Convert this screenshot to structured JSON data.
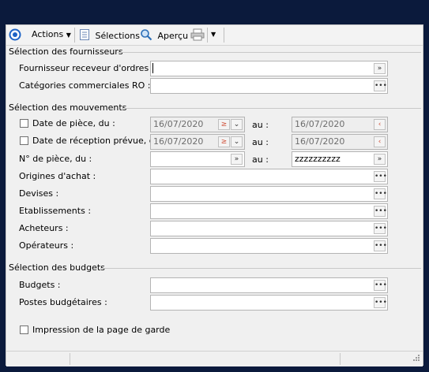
{
  "toolbar": {
    "actions": "Actions",
    "selections": "Sélections",
    "preview": "Aperçu"
  },
  "sections": {
    "suppliers": "Sélection des fournisseurs",
    "movements": "Sélection des mouvements",
    "budgets": "Sélection des budgets"
  },
  "suppliers": {
    "supplier_label": "Fournisseur receveur d'ordres :",
    "supplier_value": "",
    "categories_label": "Catégories commerciales RO :",
    "categories_value": ""
  },
  "movements": {
    "piece_date_label": "Date de pièce, du :",
    "piece_date_from": "16/07/2020",
    "piece_date_to": "16/07/2020",
    "reception_date_label": "Date de réception prévue, du :",
    "reception_date_from": "16/07/2020",
    "reception_date_to": "16/07/2020",
    "piece_no_label": "N° de pièce, du :",
    "piece_no_from": "",
    "piece_no_to": "zzzzzzzzzz",
    "to_label": "au :",
    "origins_label": "Origines d'achat :",
    "currencies_label": "Devises :",
    "establishments_label": "Etablissements :",
    "buyers_label": "Acheteurs :",
    "operators_label": "Opérateurs :"
  },
  "budgets": {
    "budgets_label": "Budgets :",
    "budget_items_label": "Postes budgétaires :"
  },
  "options": {
    "cover_page_label": "Impression de la page de garde"
  },
  "icons": {
    "browse": "…",
    "dropdown": "»",
    "calendar_arrow": "‹"
  },
  "colors": {
    "background": "#0b1a3c",
    "panel": "#f0f0f0",
    "accent_blue": "#1d63c6",
    "calendar_red": "#d0523a"
  }
}
